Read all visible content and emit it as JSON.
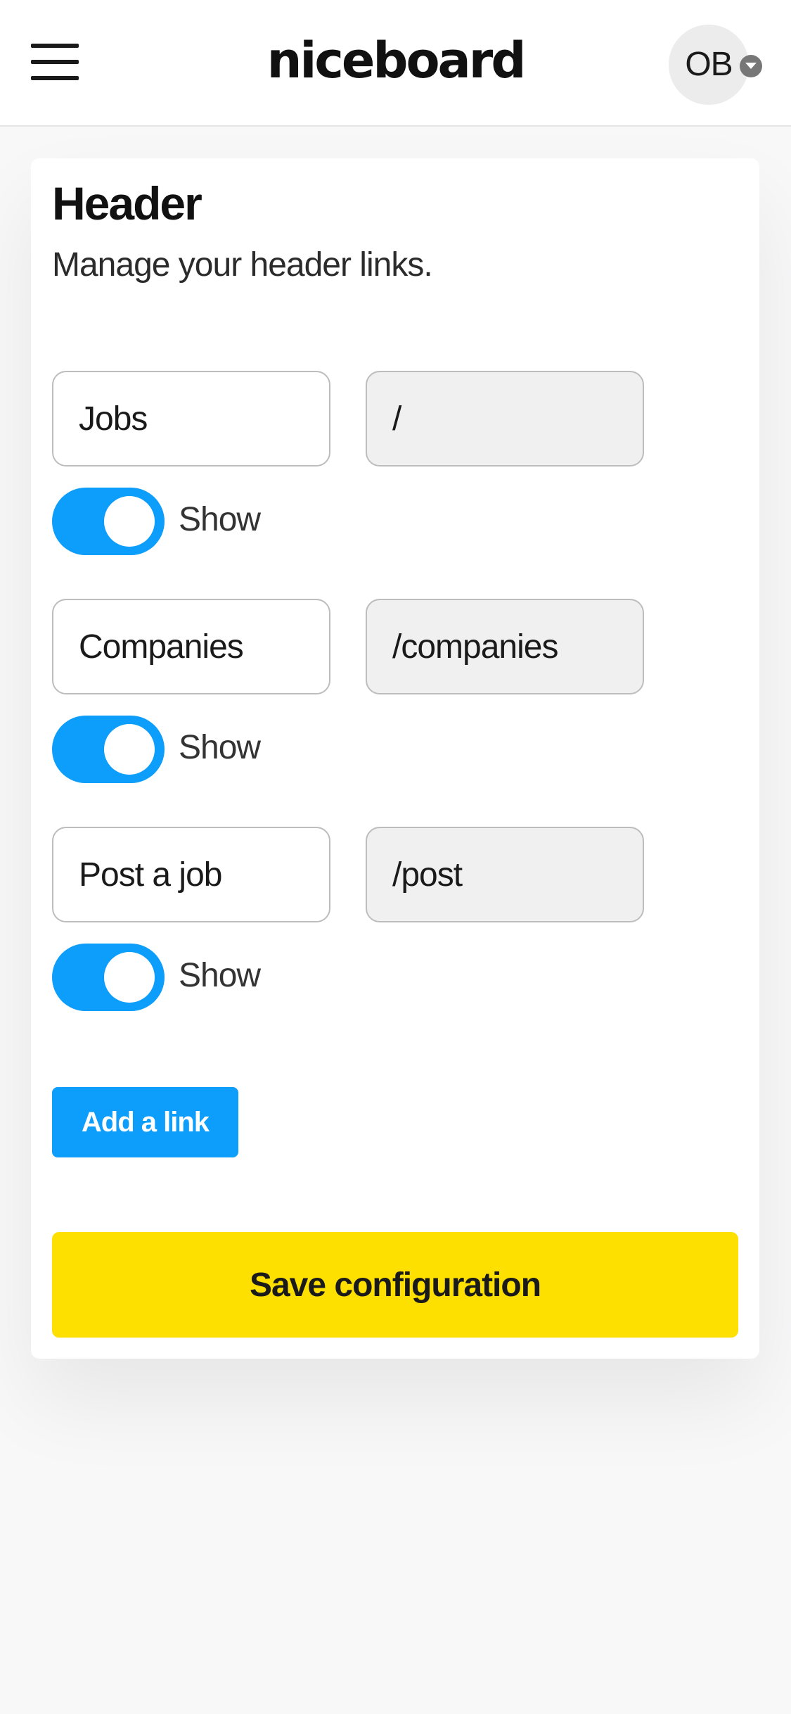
{
  "header": {
    "brand": "niceboard",
    "menu_icon": "hamburger-menu-icon",
    "avatar_initials": "OB",
    "avatar_caret_icon": "chevron-down-icon"
  },
  "section": {
    "title": "Header",
    "subtitle": "Manage your header links."
  },
  "links": [
    {
      "label": "Jobs",
      "url": "/",
      "toggle_label": "Show",
      "visible": true
    },
    {
      "label": "Companies",
      "url": "/companies",
      "toggle_label": "Show",
      "visible": true
    },
    {
      "label": "Post a job",
      "url": "/post",
      "toggle_label": "Show",
      "visible": true
    }
  ],
  "actions": {
    "add_link_label": "Add a link",
    "save_label": "Save configuration"
  },
  "colors": {
    "accent_blue": "#0d9dfb",
    "save_yellow": "#fde000",
    "url_field_bg": "#f0f0f0"
  }
}
